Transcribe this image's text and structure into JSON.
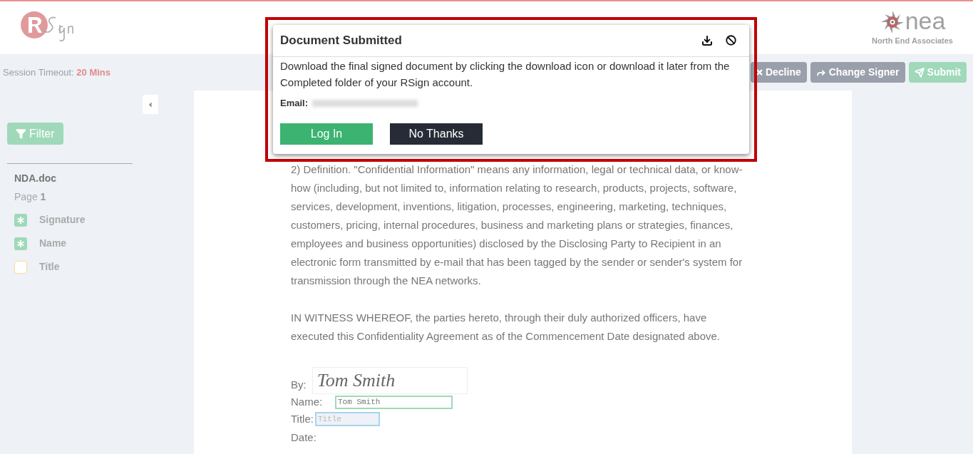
{
  "session": {
    "label": "Session Timeout:",
    "value": "20 Mins"
  },
  "actions": [
    {
      "label": "Decline",
      "kind": "decline"
    },
    {
      "label": "Change Signer",
      "kind": "change"
    },
    {
      "label": "Submit",
      "kind": "submit"
    }
  ],
  "sidebar": {
    "filter": "Filter",
    "document": "NDA.doc",
    "page_label": "Page",
    "page_number": "1",
    "fields": [
      {
        "label": "Signature",
        "completed": true
      },
      {
        "label": "Name",
        "completed": true
      },
      {
        "label": "Title",
        "completed": false
      }
    ]
  },
  "logo_right": {
    "name": "nea",
    "subtitle": "North End Associates"
  },
  "document": {
    "paragraphs": [
      "2) Definition.  \"Confidential Information\" means any information, legal or technical data, or know-how (including, but not limited to, information relating to research, products, projects, software, services, development, inventions, litigation, processes, engineering, marketing, techniques, customers, pricing, internal procedures, business and marketing plans or strategies, finances, employees and business opportunities) disclosed by the Disclosing Party to Recipient in an electronic form transmitted by e-mail that has been tagged by the sender or sender's system for transmission through the NEA networks.",
      "IN WITNESS WHEREOF, the parties hereto, through their duly authorized officers, have executed this Confidentiality Agreement as of the Commencement Date designated above."
    ],
    "by_label": "By:",
    "signature": "Tom Smith",
    "name_label": "Name:",
    "name_value": "Tom Smith",
    "title_label": "Title:",
    "title_placeholder": "Title",
    "date_label": "Date:"
  },
  "dialog": {
    "title": "Document Submitted",
    "message": "Download the final signed document by clicking the download icon or download it later from the Completed folder of your RSign account.",
    "email_label": "Email:",
    "buttons": [
      {
        "label": "Log In",
        "kind": "primary"
      },
      {
        "label": "No Thanks",
        "kind": "dark"
      }
    ]
  }
}
